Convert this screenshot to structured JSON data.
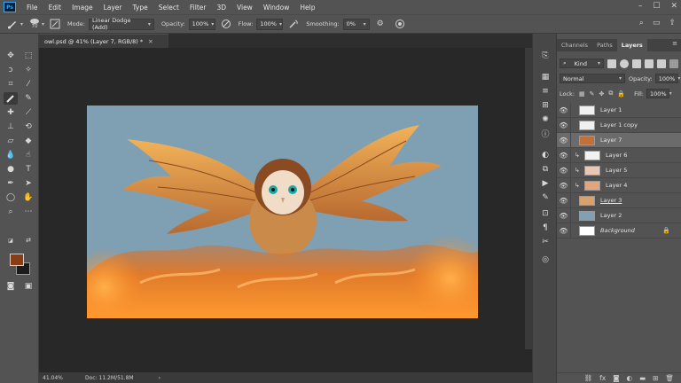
{
  "menubar": {
    "logo": "Ps",
    "items": [
      "File",
      "Edit",
      "Image",
      "Layer",
      "Type",
      "Select",
      "Filter",
      "3D",
      "View",
      "Window",
      "Help"
    ]
  },
  "options": {
    "brush_size": "70",
    "mode_label": "Mode:",
    "mode_value": "Linear Dodge (Add)",
    "opacity_label": "Opacity:",
    "opacity_value": "100%",
    "flow_label": "Flow:",
    "flow_value": "100%",
    "smoothing_label": "Smoothing:",
    "smoothing_value": "0%"
  },
  "document": {
    "tab_title": "owl.psd @ 41% (Layer 7, RGB/8) *",
    "zoom": "41.04%",
    "doc_size": "Doc: 11.2M/51.8M",
    "status_arrow": "›"
  },
  "panel": {
    "tabs": [
      "Channels",
      "Paths",
      "Layers"
    ],
    "filter_label": "Kind",
    "blend_mode": "Normal",
    "opacity_label": "Opacity:",
    "opacity_value": "100%",
    "lock_label": "Lock:",
    "fill_label": "Fill:",
    "fill_value": "100%",
    "layers": [
      {
        "name": "Layer 1",
        "clipped": false,
        "selected": false,
        "thumb": "#f0f0f0",
        "style": ""
      },
      {
        "name": "Layer 1 copy",
        "clipped": false,
        "selected": false,
        "thumb": "#f0f0f0",
        "style": ""
      },
      {
        "name": "Layer 7",
        "clipped": false,
        "selected": true,
        "thumb": "#c0703a",
        "style": ""
      },
      {
        "name": "Layer 6",
        "clipped": true,
        "selected": false,
        "thumb": "#f2f2f2",
        "style": ""
      },
      {
        "name": "Layer 5",
        "clipped": true,
        "selected": false,
        "thumb": "#e9c7b5",
        "style": ""
      },
      {
        "name": "Layer 4",
        "clipped": true,
        "selected": false,
        "thumb": "#e3a57e",
        "style": ""
      },
      {
        "name": "Layer 3",
        "clipped": false,
        "selected": false,
        "thumb": "#d9a070",
        "style": "underline"
      },
      {
        "name": "Layer 2",
        "clipped": false,
        "selected": false,
        "thumb": "#7fa0b5",
        "style": ""
      },
      {
        "name": "Background",
        "clipped": false,
        "selected": false,
        "thumb": "#ffffff",
        "style": "italic",
        "locked": true
      }
    ]
  },
  "colors": {
    "foreground": "#8a3c12",
    "background": "#1c1c1c",
    "canvas_sky": "#7f9fb2",
    "accent": "#31a8ff"
  }
}
